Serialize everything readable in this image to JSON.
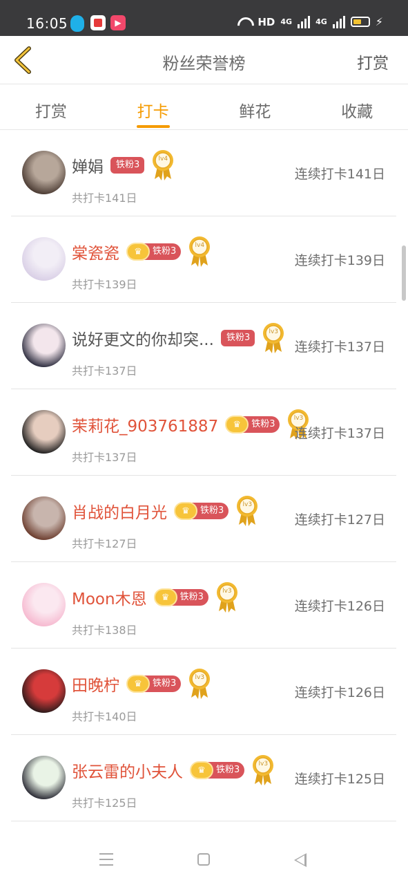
{
  "status_bar": {
    "time": "16:05",
    "network": "HD",
    "signal1": "4G",
    "signal2": "4G",
    "bolt": "⚡"
  },
  "header": {
    "title": "粉丝荣誉榜",
    "action": "打赏"
  },
  "tabs": [
    {
      "label": "打赏",
      "active": false
    },
    {
      "label": "打卡",
      "active": true
    },
    {
      "label": "鲜花",
      "active": false
    },
    {
      "label": "收藏",
      "active": false
    }
  ],
  "rows": [
    {
      "name": "婵娟",
      "name_color": "gray",
      "crown": false,
      "tag": "铁粉3",
      "level": "lv4",
      "total": "共打卡141日",
      "streak": "连续打卡141日",
      "avatar_colors": [
        "#4a3a32",
        "#b7a79a"
      ]
    },
    {
      "name": "棠瓷瓷",
      "name_color": "red",
      "crown": true,
      "tag": "铁粉3",
      "level": "lv4",
      "total": "共打卡139日",
      "streak": "连续打卡139日",
      "avatar_colors": [
        "#d9cfe6",
        "#f2eef6"
      ]
    },
    {
      "name": "说好更文的你却突...",
      "name_color": "gray",
      "crown": false,
      "tag": "铁粉3",
      "level": "lv3",
      "total": "共打卡137日",
      "streak": "连续打卡137日",
      "avatar_colors": [
        "#2b2b3d",
        "#f3e6ec"
      ]
    },
    {
      "name": "茉莉花_903761887",
      "name_color": "red",
      "crown": true,
      "tag": "铁粉3",
      "level": "lv3",
      "total": "共打卡137日",
      "streak": "连续打卡137日",
      "avatar_colors": [
        "#1c1c1c",
        "#e6cdbf"
      ]
    },
    {
      "name": "肖战的白月光",
      "name_color": "red",
      "crown": true,
      "tag": "铁粉3",
      "level": "lv3",
      "total": "共打卡127日",
      "streak": "连续打卡127日",
      "avatar_colors": [
        "#6b3c2d",
        "#c8b5ad"
      ]
    },
    {
      "name": "Moon木恩",
      "name_color": "red",
      "crown": true,
      "tag": "铁粉3",
      "level": "lv3",
      "total": "共打卡138日",
      "streak": "连续打卡126日",
      "avatar_colors": [
        "#f6b8cf",
        "#fbe8f0"
      ]
    },
    {
      "name": "田晚柠",
      "name_color": "red",
      "crown": true,
      "tag": "铁粉3",
      "level": "lv3",
      "total": "共打卡140日",
      "streak": "连续打卡126日",
      "avatar_colors": [
        "#2a1a1a",
        "#d63b3b"
      ]
    },
    {
      "name": "张云雷的小夫人",
      "name_color": "red",
      "crown": true,
      "tag": "铁粉3",
      "level": "lv3",
      "total": "共打卡125日",
      "streak": "连续打卡125日",
      "avatar_colors": [
        "#2b2b35",
        "#e9f3e6"
      ]
    }
  ],
  "colors": {
    "accent": "#f59b00",
    "tag": "#d9545a",
    "name_red": "#e0533a"
  }
}
